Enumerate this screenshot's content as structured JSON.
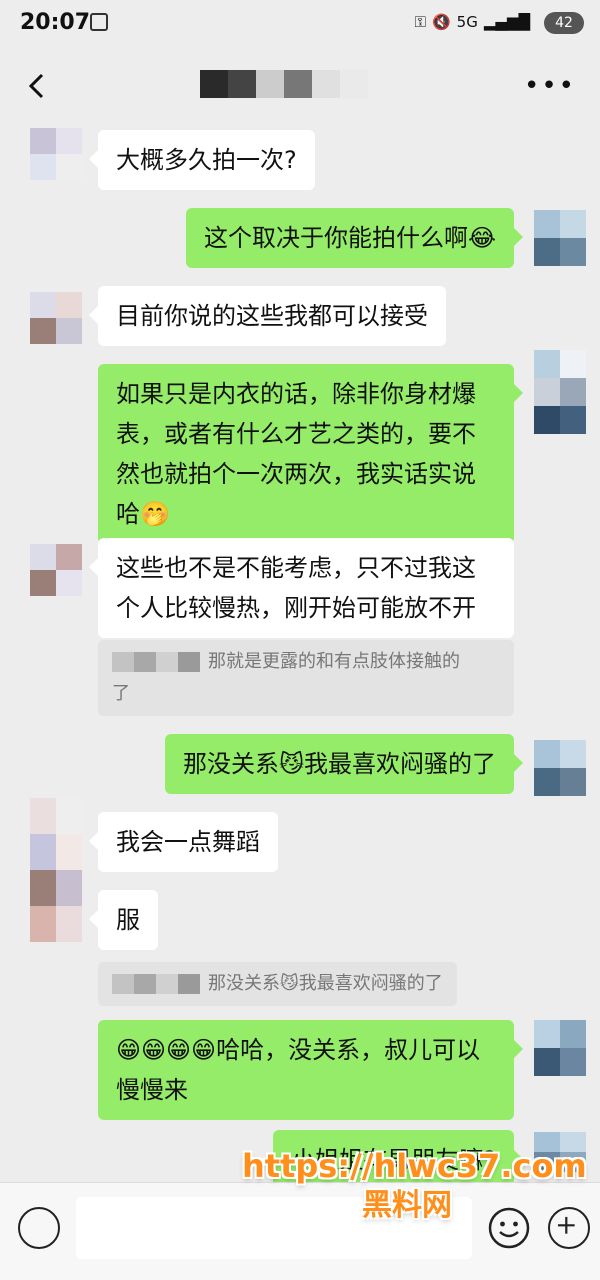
{
  "status": {
    "time": "20:07",
    "signal": "5G",
    "battery": "42"
  },
  "header": {
    "back_icon": "chevron-left-icon",
    "more_icon": "ellipsis-icon"
  },
  "messages": [
    {
      "text": "大概多久拍一次?"
    },
    {
      "text": "这个取决于你能拍什么啊😂"
    },
    {
      "text": "目前你说的这些我都可以接受"
    },
    {
      "text": "如果只是内衣的话，除非你身材爆\n表，或者有什么才艺之类的，要不\n然也就拍个一次两次，我实话实说\n哈🤭"
    },
    {
      "text": "这些也不是不能考虑，只不过我这\n个人比较慢热，刚开始可能放不开"
    },
    {
      "text": "那就是更露的和有点肢体接触的\n了"
    },
    {
      "text": "那没关系😼我最喜欢闷骚的了"
    },
    {
      "text": "我会一点舞蹈"
    },
    {
      "text": "服"
    },
    {
      "text": "那没关系😼我最喜欢闷骚的了"
    },
    {
      "text": "😁😁😁😁哈哈，没关系，叔儿可以\n慢慢来"
    },
    {
      "text": "小姐姐有男朋友嘛?"
    }
  ],
  "watermark": {
    "url": "https://hlwc37.com",
    "name": "黑料网"
  },
  "colors": {
    "background": "#ededed",
    "bubble_in": "#ffffff",
    "bubble_out": "#95ec69"
  }
}
